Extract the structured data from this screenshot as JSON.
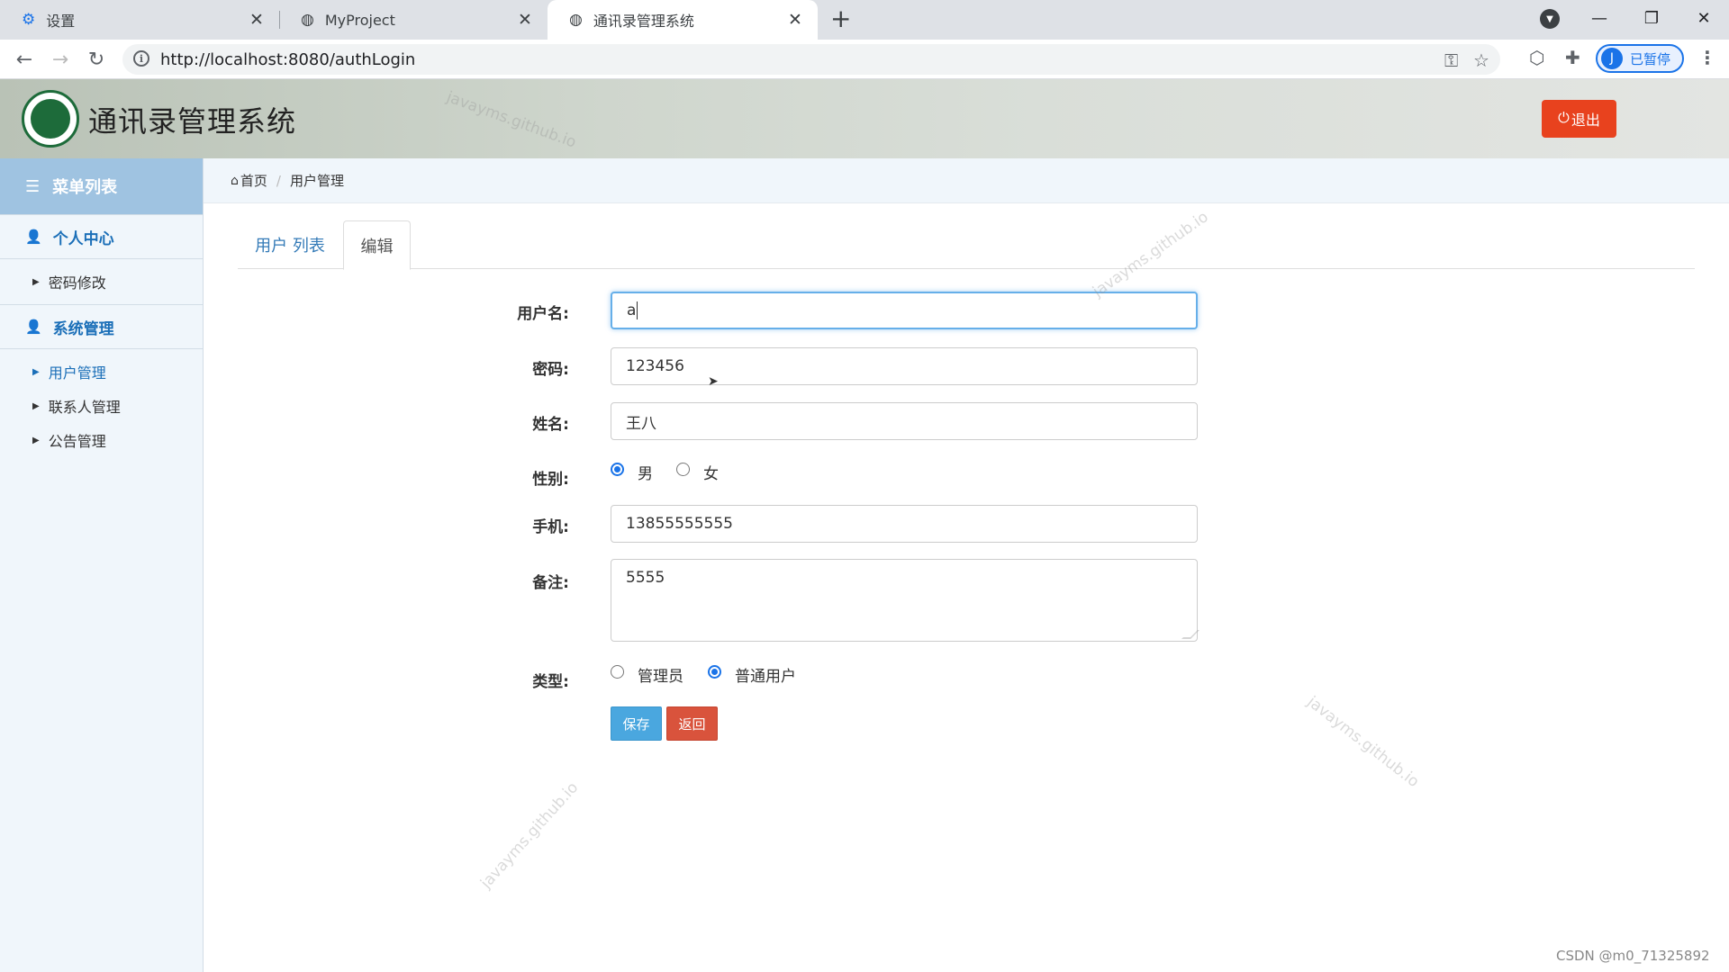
{
  "browser": {
    "tabs": [
      {
        "label": "设置",
        "icon": "gear-icon"
      },
      {
        "label": "MyProject",
        "icon": "globe-icon"
      },
      {
        "label": "通讯录管理系统",
        "icon": "globe-icon"
      }
    ],
    "url": "http://localhost:8080/authLogin",
    "profile_initial": "J",
    "profile_status": "已暂停"
  },
  "header": {
    "title": "通讯录管理系统",
    "logout_label": "退出"
  },
  "sidebar": {
    "title": "菜单列表",
    "groups": [
      {
        "label": "个人中心",
        "items": [
          {
            "label": "密码修改"
          }
        ]
      },
      {
        "label": "系统管理",
        "items": [
          {
            "label": "用户管理"
          },
          {
            "label": "联系人管理"
          },
          {
            "label": "公告管理"
          }
        ]
      }
    ]
  },
  "breadcrumb": {
    "home": "首页",
    "current": "用户管理"
  },
  "page_tabs": {
    "list": "用户 列表",
    "edit": "编辑"
  },
  "form": {
    "username_label": "用户名:",
    "username_value": "a",
    "password_label": "密码:",
    "password_value": "123456",
    "name_label": "姓名:",
    "name_value": "王八",
    "gender_label": "性别:",
    "gender_options": [
      "男",
      "女"
    ],
    "gender_selected": "男",
    "phone_label": "手机:",
    "phone_value": "13855555555",
    "remark_label": "备注:",
    "remark_value": "5555",
    "type_label": "类型:",
    "type_options": [
      "管理员",
      "普通用户"
    ],
    "type_selected": "普通用户",
    "save_label": "保存",
    "back_label": "返回"
  },
  "watermark_text": "javayms.github.io",
  "footer_credit": "CSDN @m0_71325892",
  "colors": {
    "accent": "#1b6fb8",
    "logout": "#e8421e",
    "save": "#4aa7df",
    "back": "#d9533c",
    "sidebar_head": "#9fc3e1"
  }
}
